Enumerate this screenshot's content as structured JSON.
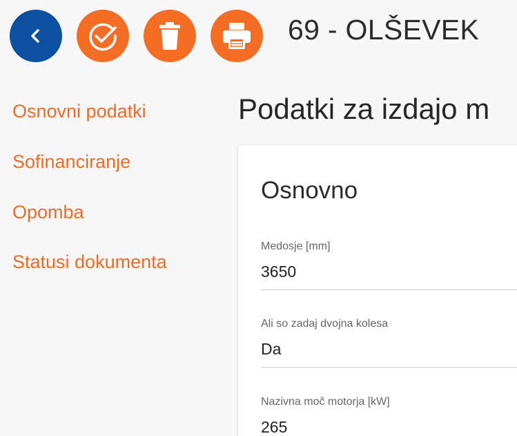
{
  "toolbar": {
    "back_icon": "chevron-left-icon",
    "confirm_icon": "check-circle-icon",
    "delete_icon": "trash-icon",
    "print_icon": "printer-icon",
    "colors": {
      "back": "#0d4fa0",
      "action": "#f46d25"
    }
  },
  "header": {
    "title": "69 - OLŠEVEK"
  },
  "sidebar": {
    "items": [
      {
        "label": "Osnovni podatki"
      },
      {
        "label": "Sofinanciranje"
      },
      {
        "label": "Opomba"
      },
      {
        "label": "Statusi dokumenta"
      }
    ]
  },
  "main": {
    "section_title": "Podatki za izdajo m",
    "card": {
      "title": "Osnovno",
      "fields": [
        {
          "label": "Medosje [mm]",
          "value": "3650"
        },
        {
          "label": "Ali so zadaj dvojna kolesa",
          "value": "Da"
        },
        {
          "label": "Nazivna moč motorja [kW]",
          "value": "265"
        }
      ]
    }
  }
}
